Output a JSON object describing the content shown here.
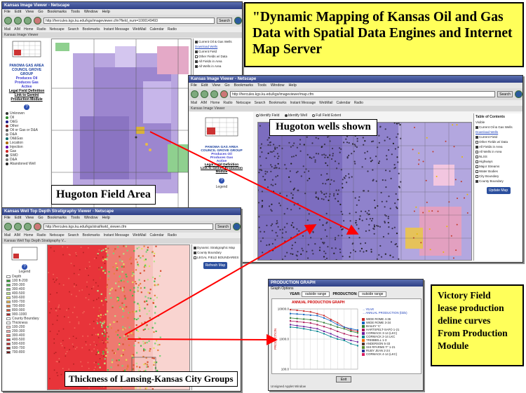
{
  "title_box": {
    "text": "\"Dynamic Mapping of Kansas Oil and Gas Data with Spatial Data Engines and Internet Map Server"
  },
  "victory_box": {
    "lines": [
      "Victory Field",
      "lease production",
      "deline curves",
      "From Production",
      "Module"
    ]
  },
  "labels": {
    "hugoton_area": "Hugoton Field Area",
    "hugoton_wells": "Hugoton wells shown",
    "thickness": "Thickness of Lansing-Kansas City Groups"
  },
  "win1": {
    "title": "Kansas Image Viewer - Netscape",
    "menu": [
      "File",
      "Edit",
      "View",
      "Go",
      "Bookmarks",
      "Tools",
      "Window",
      "Help"
    ],
    "url": "http://hercules.kgs.ku.edu/kgs/imageviewer.cfm?field_num=1000149493",
    "search": "Search",
    "personal": [
      "Mail",
      "AIM",
      "Home",
      "Radio",
      "Netscape",
      "Search",
      "Bookmarks",
      "Instant Message",
      "WebMail",
      "Calendar",
      "Radio"
    ],
    "tab": "Kansas Image Viewer",
    "side_heading": [
      "PANOMA GAS AREA",
      "COUNCIL GROVE",
      "GROUP"
    ],
    "side_links": [
      "Produces Oil",
      "Produces Gas",
      "Active",
      "Legal Field Definition",
      "Link to Gemini",
      "Production Module"
    ],
    "legend_items": [
      "Unknown",
      "Oil",
      "O&G",
      "Other",
      "Oil or Gas or D&A",
      "D&A",
      "Oil&Gas",
      "Location",
      "Injection",
      "Gas",
      "SWD",
      "D&A",
      "Abandoned Well"
    ]
  },
  "win2": {
    "title": "Kansas Image Viewer - Netscape",
    "menu": [
      "File",
      "Edit",
      "View",
      "Go",
      "Bookmarks",
      "Tools",
      "Window",
      "Help"
    ],
    "url": "http://hercules.kgs.ku.edu/kgs/imageviewer/map.cfm",
    "search": "Search",
    "tab": "Kansas Image Viewer",
    "radio": [
      "Identify Field",
      "Identify Well",
      "Full Field Extent"
    ],
    "toc_title": "Table of Contents",
    "toc_items": [
      "Visible",
      "Current Oil & Gas Wells",
      "Download Wells",
      "Current Field",
      "Other Fields w/ Data",
      "All Fields in Area",
      "All Wells in Area",
      "NLSS",
      "Highways",
      "Major Streams",
      "Water Bodies",
      "City Boundary",
      "County Boundary"
    ],
    "refresh": "Update Map",
    "side_lines": [
      "PANOMA GAS AREA",
      "COUNCIL GROVE GROUP",
      "Produces Oil",
      "Produces Gas",
      "Active",
      "Legal Field Definition",
      "Link to Gemini Production",
      "Module"
    ],
    "legend": "Legend"
  },
  "win3": {
    "title": "Kansas Well Top Depth Stratigraphy Viewer - Netscape",
    "menu": [
      "File",
      "Edit",
      "View",
      "Go",
      "Bookmarks",
      "Tools",
      "Window",
      "Help"
    ],
    "url": "http://hercules.kgs.ku.edu/kgs/strat/kwtd_viewer.cfm",
    "search": "Search",
    "tab": "Kansas Well Top Depth Stratigraphy V...",
    "toc_items": [
      "Dynamic Stratigraphic Map",
      "County Boundary",
      "LEGAL FIELD BOUNDARIES"
    ],
    "refresh": "Refresh Map",
    "legend": "Legend",
    "legend_items": [
      "Depth",
      "100 ft-200",
      "200-300",
      "300-400",
      "400-500",
      "500-600",
      "600-700",
      "700-800",
      "800-900",
      "900-1000",
      "County Boundary",
      "Thickness",
      "100-200",
      "200-300",
      "300-400",
      "400-500",
      "500-600",
      "600-700",
      "700-800"
    ]
  },
  "win4": {
    "title": "PRODUCTION GRAPH",
    "options": "Graph Options",
    "year_label": "YEAR:",
    "year_value": "outside range",
    "production_label": "PRODUCTION:",
    "production_value": "outside range",
    "graph_title": "ANNUAL PRODUCTION GRAPH",
    "legend_head": [
      "YEAR",
      "ANNUAL PRODUCTION (bbls)"
    ],
    "series": [
      "WIDE ROME 4-36",
      "WIDE ROME 3-34",
      "BAILEY 'C'",
      "HARTSFELT-SAFO 1-21",
      "CORMACK 3-14 (LKC)",
      "CORMACK 2-14 LKC",
      "TREBBELL 1-3",
      "ANDERSON 5-33",
      "SHI RFARMS 'F' 1-21",
      "RUBY JEAN 2-24",
      "CORMACK 4-14 (LKC)"
    ],
    "y_ticks": [
      "10000.0",
      "1000.0",
      "100.0"
    ],
    "y_label": "PRODUCTION",
    "exit": "Exit",
    "status": "Unsigned Applet Window"
  },
  "colors": {
    "yellow": "#ffff5a",
    "red_arrow": "#ff0000",
    "map_purple": "#8c7ac0",
    "map_pink": "#f2a6a6",
    "map_red": "#e8343a"
  },
  "chart_data": {
    "type": "line",
    "title": "ANNUAL PRODUCTION GRAPH",
    "ylabel": "PRODUCTION",
    "yscale": "log",
    "ylim": [
      100,
      10000
    ],
    "x": [
      1,
      2,
      3,
      4,
      5,
      6,
      7,
      8,
      9,
      10,
      11
    ],
    "series": [
      {
        "name": "WIDE ROME 4-36",
        "values": [
          9500,
          9000,
          8500,
          8000,
          7000,
          6000,
          4500,
          3500,
          2500,
          2000,
          1800
        ]
      },
      {
        "name": "WIDE ROME 3-34",
        "values": [
          7000,
          6800,
          6500,
          6200,
          6000,
          5000,
          4000,
          3000,
          2500,
          2200,
          2000
        ]
      },
      {
        "name": "BAILEY 'C'",
        "values": [
          5000,
          4800,
          4600,
          4400,
          4000,
          3500,
          3000,
          2500,
          2200,
          1800,
          1600
        ]
      },
      {
        "name": "HARTSFELT-SAFO 1-21",
        "values": [
          4000,
          3800,
          3600,
          3400,
          3000,
          2600,
          2200,
          1800,
          1500,
          1300,
          1200
        ]
      },
      {
        "name": "CORMACK 3-14 (LKC)",
        "values": [
          3000,
          2800,
          2600,
          2400,
          2200,
          1800,
          1500,
          1200,
          1000,
          900,
          800
        ]
      },
      {
        "name": "CORMACK 2-14 LKC",
        "values": [
          2500,
          2400,
          2200,
          2000,
          1800,
          1500,
          1200,
          1000,
          900,
          700,
          600
        ]
      }
    ]
  }
}
